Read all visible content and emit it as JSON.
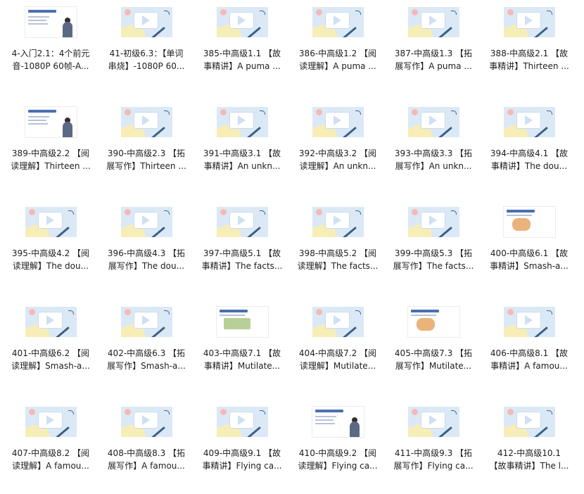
{
  "items": [
    {
      "line1": "4-入门2.1：4个前元",
      "line2": "音-1080P 60帧-A...",
      "thumb": "slide-person",
      "icon": "video-thumbnail-icon"
    },
    {
      "line1": "41-初级6.3：【单词",
      "line2": "串烧】-1080P 60...",
      "thumb": "video",
      "icon": "video-thumbnail-icon"
    },
    {
      "line1": "385-中高级1.1 【故",
      "line2": "事精讲】A puma ...",
      "thumb": "video",
      "icon": "video-thumbnail-icon"
    },
    {
      "line1": "386-中高级1.2 【阅",
      "line2": "读理解】A puma ...",
      "thumb": "video",
      "icon": "video-thumbnail-icon"
    },
    {
      "line1": "387-中高级1.3 【拓",
      "line2": "展写作】A puma ...",
      "thumb": "video",
      "icon": "video-thumbnail-icon"
    },
    {
      "line1": "388-中高级2.1 【故",
      "line2": "事精讲】Thirteen ...",
      "thumb": "video",
      "icon": "video-thumbnail-icon"
    },
    {
      "line1": "389-中高级2.2 【阅",
      "line2": "读理解】Thirteen ...",
      "thumb": "slide-person",
      "icon": "video-thumbnail-icon"
    },
    {
      "line1": "390-中高级2.3 【拓",
      "line2": "展写作】Thirteen ...",
      "thumb": "video",
      "icon": "video-thumbnail-icon"
    },
    {
      "line1": "391-中高级3.1 【故",
      "line2": "事精讲】An unkn...",
      "thumb": "video",
      "icon": "video-thumbnail-icon"
    },
    {
      "line1": "392-中高级3.2 【阅",
      "line2": "读理解】An unkn...",
      "thumb": "video",
      "icon": "video-thumbnail-icon"
    },
    {
      "line1": "393-中高级3.3 【拓",
      "line2": "展写作】An unkn...",
      "thumb": "video",
      "icon": "video-thumbnail-icon"
    },
    {
      "line1": "394-中高级4.1 【故",
      "line2": "事精讲】The dou...",
      "thumb": "video",
      "icon": "video-thumbnail-icon"
    },
    {
      "line1": "395-中高级4.2 【阅",
      "line2": "读理解】The dou...",
      "thumb": "video",
      "icon": "video-thumbnail-icon"
    },
    {
      "line1": "396-中高级4.3 【拓",
      "line2": "展写作】The dou...",
      "thumb": "video",
      "icon": "video-thumbnail-icon"
    },
    {
      "line1": "397-中高级5.1 【故",
      "line2": "事精讲】The facts...",
      "thumb": "video",
      "icon": "video-thumbnail-icon"
    },
    {
      "line1": "398-中高级5.2 【阅",
      "line2": "读理解】The facts...",
      "thumb": "video",
      "icon": "video-thumbnail-icon"
    },
    {
      "line1": "399-中高级5.3 【拓",
      "line2": "展写作】The facts...",
      "thumb": "video",
      "icon": "video-thumbnail-icon"
    },
    {
      "line1": "400-中高级6.1 【故",
      "line2": "事精讲】Smash-a...",
      "thumb": "slide-food",
      "icon": "video-thumbnail-icon"
    },
    {
      "line1": "401-中高级6.2 【阅",
      "line2": "读理解】Smash-a...",
      "thumb": "video",
      "icon": "video-thumbnail-icon"
    },
    {
      "line1": "402-中高级6.3 【拓",
      "line2": "展写作】Smash-a...",
      "thumb": "video",
      "icon": "video-thumbnail-icon"
    },
    {
      "line1": "403-中高级7.1 【故",
      "line2": "事精讲】Mutilate...",
      "thumb": "slide-money",
      "icon": "video-thumbnail-icon"
    },
    {
      "line1": "404-中高级7.2 【阅",
      "line2": "读理解】Mutilate...",
      "thumb": "video",
      "icon": "video-thumbnail-icon"
    },
    {
      "line1": "405-中高级7.3 【拓",
      "line2": "展写作】Mutilate...",
      "thumb": "slide-food",
      "icon": "video-thumbnail-icon"
    },
    {
      "line1": "406-中高级8.1 【故",
      "line2": "事精讲】A famou...",
      "thumb": "video",
      "icon": "video-thumbnail-icon"
    },
    {
      "line1": "407-中高级8.2 【阅",
      "line2": "读理解】A famou...",
      "thumb": "video",
      "icon": "video-thumbnail-icon"
    },
    {
      "line1": "408-中高级8.3 【拓",
      "line2": "展写作】A famou...",
      "thumb": "video",
      "icon": "video-thumbnail-icon"
    },
    {
      "line1": "409-中高级9.1 【故",
      "line2": "事精讲】Flying ca...",
      "thumb": "video",
      "icon": "video-thumbnail-icon"
    },
    {
      "line1": "410-中高级9.2 【阅",
      "line2": "读理解】Flying ca...",
      "thumb": "slide-person",
      "icon": "video-thumbnail-icon"
    },
    {
      "line1": "411-中高级9.3 【拓",
      "line2": "展写作】Flying ca...",
      "thumb": "video",
      "icon": "video-thumbnail-icon"
    },
    {
      "line1": "412-中高级10.1",
      "line2": "【故事精讲】The l...",
      "thumb": "video",
      "icon": "video-thumbnail-icon"
    }
  ]
}
